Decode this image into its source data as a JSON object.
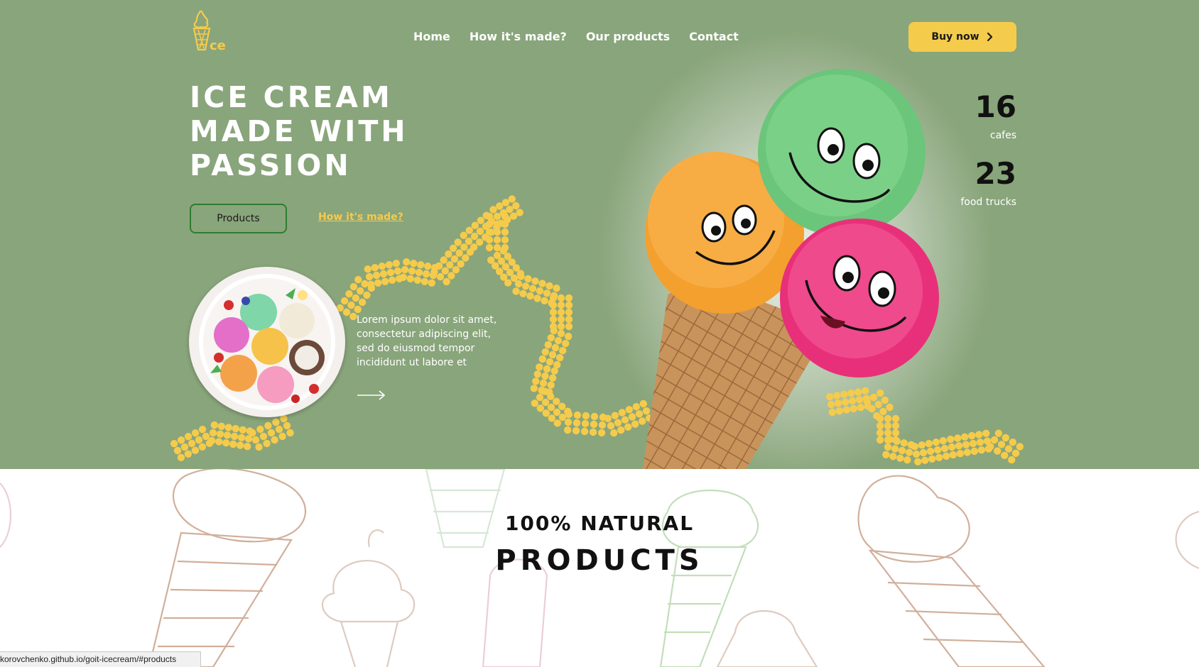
{
  "logo": {
    "icon": "ice-cream-logo-icon",
    "text": "ice"
  },
  "nav": {
    "items": [
      "Home",
      "How it's made?",
      "Our products",
      "Contact"
    ],
    "buy_label": "Buy now",
    "buy_icon": "chevron-right-icon"
  },
  "hero": {
    "title_lines": [
      "ICE CREAM",
      "MADE WITH",
      "PASSION"
    ],
    "products_button": "Products",
    "how_link": "How it's made?",
    "description": "Lorem ipsum dolor sit amet, consectetur adipiscing elit, sed do eiusmod tempor incididunt ut labore et",
    "arrow_icon": "arrow-right-icon"
  },
  "stats": [
    {
      "value": "16",
      "label": "cafes"
    },
    {
      "value": "23",
      "label": "food trucks"
    }
  ],
  "products_section": {
    "subtitle": "100% NATURAL",
    "title": "PRODUCTS"
  },
  "status_bar": {
    "url": "korovchenko.github.io/goit-icecream/#products"
  },
  "colors": {
    "hero_bg": "#89a57b",
    "accent_yellow": "#f5cb4c",
    "button_border": "#2e7d32"
  }
}
